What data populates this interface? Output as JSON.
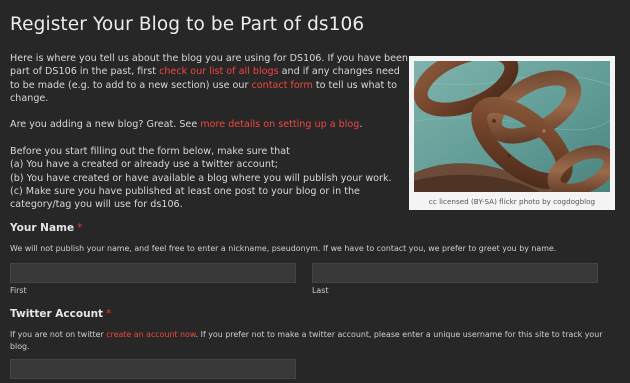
{
  "page": {
    "title": "Register Your Blog to be Part of ds106"
  },
  "intro": {
    "p1_a": "Here is where you tell us about the blog you are using for DS106. If you have been part of DS106 in the past, first ",
    "p1_link1": "check our list of all blogs",
    "p1_b": " and if any changes need to be made (e.g. to add to a new section) use our ",
    "p1_link2": "contact form",
    "p1_c": " to tell us what to change.",
    "p2_a": "Are you adding a new blog? Great. See ",
    "p2_link": "more details on setting up a blog",
    "p2_b": ".",
    "p3_lead": "Before you start filling out the form below, make sure that",
    "p3_a": "(a) You have a created or already use a twitter account;",
    "p3_b": "(b) You have created or have available a blog where you will publish your work.",
    "p3_c": "(c) Make sure you have published at least one post to your blog or in the category/tag you will use for ds106."
  },
  "photo": {
    "caption": "cc licensed (BY-SA) flickr photo by cogdogblog"
  },
  "name_section": {
    "label": "Your Name",
    "required_mark": "*",
    "help": "We will not publish your name, and feel free to enter a nickname, pseudonym. If we have to contact you, we prefer to greet you by name.",
    "first_value": "",
    "last_value": "",
    "first_label": "First",
    "last_label": "Last"
  },
  "twitter_section": {
    "label": "Twitter Account",
    "required_mark": "*",
    "help_a": "If you are not on twitter ",
    "help_link": "create an account now",
    "help_b": ". If you prefer not to make a twitter account, please enter a unique username for this site to track your blog.",
    "value": ""
  },
  "colors": {
    "background": "#272727",
    "link": "#f0473f",
    "required": "#e03b34",
    "input_bg": "#393939"
  }
}
